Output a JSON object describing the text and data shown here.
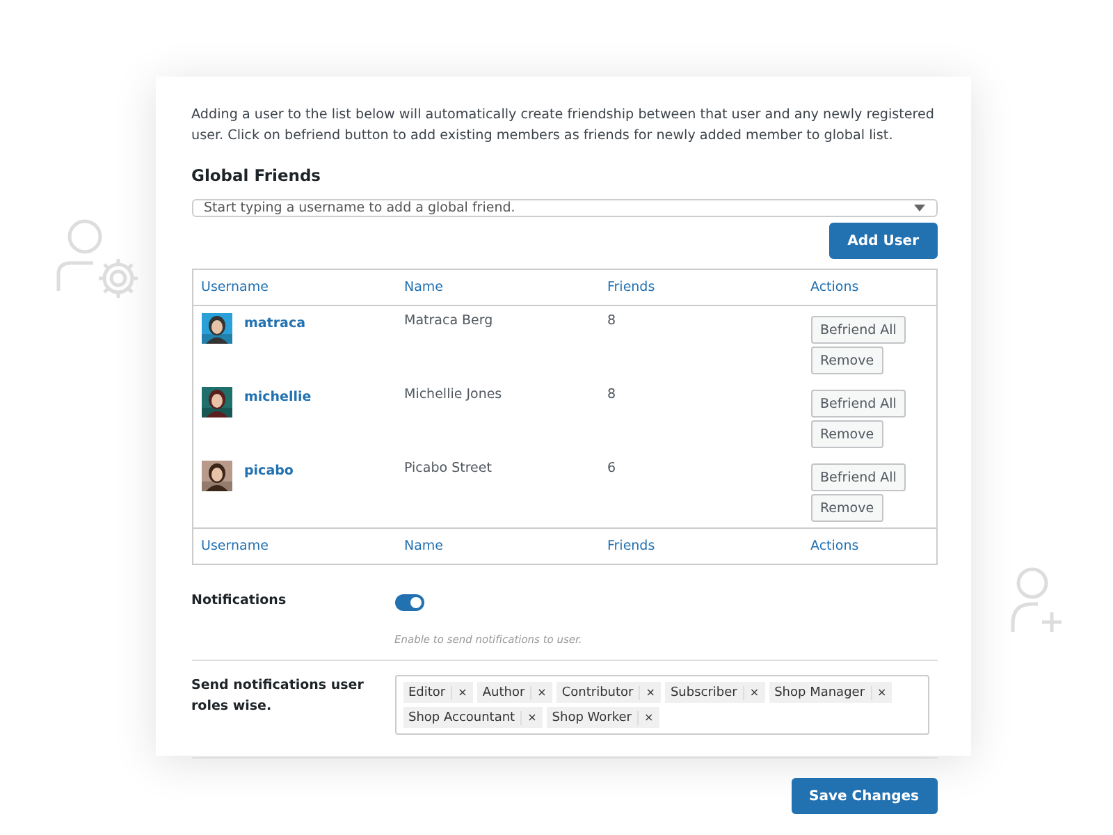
{
  "intro": "Adding a user to the list below will automatically create friendship between that user and any newly registered user. Click on befriend button to add existing members as friends for newly added member to global list.",
  "section_title": "Global Friends",
  "user_select": {
    "placeholder": "Start typing a username to add a global friend."
  },
  "add_button": "Add User",
  "table": {
    "columns": [
      "Username",
      "Name",
      "Friends",
      "Actions"
    ],
    "rows": [
      {
        "username": "matraca",
        "name": "Matraca Berg",
        "friends": "8",
        "actions": [
          "Befriend All",
          "Remove"
        ]
      },
      {
        "username": "michellie",
        "name": "Michellie Jones",
        "friends": "8",
        "actions": [
          "Befriend All",
          "Remove"
        ]
      },
      {
        "username": "picabo",
        "name": "Picabo Street",
        "friends": "6",
        "actions": [
          "Befriend All",
          "Remove"
        ]
      }
    ],
    "footer": [
      "Username",
      "Name",
      "Friends",
      "Actions"
    ]
  },
  "notifications": {
    "label": "Notifications",
    "on": true,
    "hint": "Enable to send notifications to user."
  },
  "roles": {
    "label": "Send notifications user roles wise.",
    "tags": [
      {
        "label": "Editor",
        "remove": "×"
      },
      {
        "label": "Author",
        "remove": "×"
      },
      {
        "label": "Contributor",
        "remove": "×"
      },
      {
        "label": "Subscriber",
        "remove": "×"
      },
      {
        "label": "Shop Manager",
        "remove": "×"
      },
      {
        "label": "Shop Accountant",
        "remove": "×"
      },
      {
        "label": "Shop Worker",
        "remove": "×"
      }
    ]
  },
  "save_button": "Save Changes"
}
